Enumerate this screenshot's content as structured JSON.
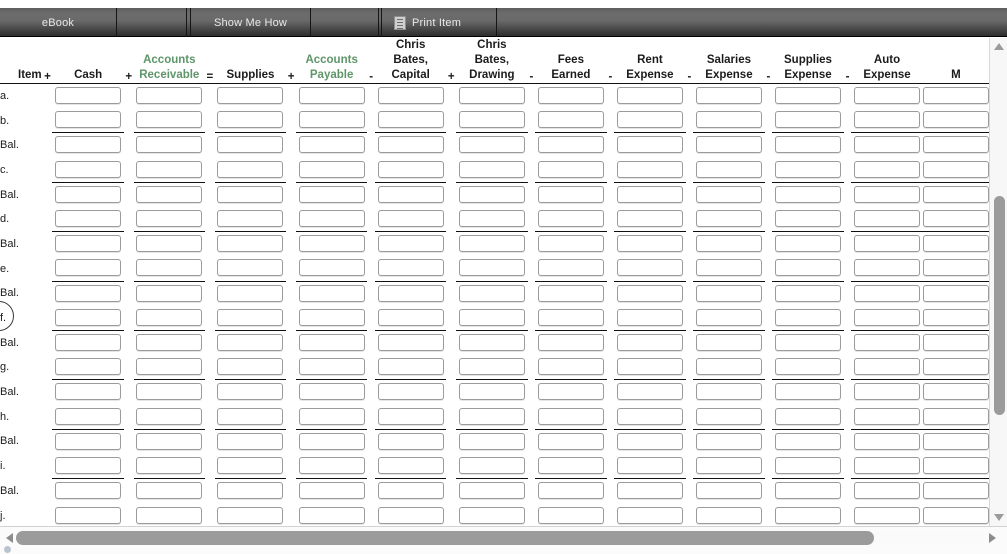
{
  "toolbar": {
    "buttons": [
      {
        "name": "ebook",
        "label": "eBook",
        "icon": ""
      },
      {
        "name": "spacer-1",
        "label": "",
        "icon": ""
      },
      {
        "name": "show-me-how",
        "label": "Show Me How",
        "icon": ""
      },
      {
        "name": "spacer-2",
        "label": "",
        "icon": ""
      },
      {
        "name": "print-item",
        "label": "Print Item",
        "icon": "document-icon"
      },
      {
        "name": "spacer-3",
        "label": "",
        "icon": ""
      }
    ]
  },
  "worksheet": {
    "columns": [
      {
        "key": "item",
        "line1": "",
        "line2": "Item",
        "color": "black",
        "op": ""
      },
      {
        "key": "cash",
        "line1": "",
        "line2": "Cash",
        "color": "black",
        "op": "+"
      },
      {
        "key": "accounts_receivable",
        "line1": "Accounts",
        "line2": "Receivable",
        "color": "green",
        "op": "+"
      },
      {
        "key": "supplies",
        "line1": "",
        "line2": "Supplies",
        "color": "black",
        "op": "="
      },
      {
        "key": "accounts_payable",
        "line1": "Accounts",
        "line2": "Payable",
        "color": "green",
        "op": "+"
      },
      {
        "key": "capital",
        "line1": "Chris",
        "line2": "Bates,",
        "line3": "Capital",
        "color": "black",
        "op": "-"
      },
      {
        "key": "drawing",
        "line1": "Chris",
        "line2": "Bates,",
        "line3": "Drawing",
        "color": "black",
        "op": "+"
      },
      {
        "key": "fees_earned",
        "line1": "Fees",
        "line2": "Earned",
        "color": "black",
        "op": "-"
      },
      {
        "key": "rent_expense",
        "line1": "Rent",
        "line2": "Expense",
        "color": "black",
        "op": "-"
      },
      {
        "key": "salaries_expense",
        "line1": "Salaries",
        "line2": "Expense",
        "color": "black",
        "op": "-"
      },
      {
        "key": "supplies_expense",
        "line1": "Supplies",
        "line2": "Expense",
        "color": "black",
        "op": "-"
      },
      {
        "key": "auto_expense",
        "line1": "Auto",
        "line2": "Expense",
        "color": "black",
        "op": "-"
      },
      {
        "key": "misc_expense",
        "line1": "",
        "line2": "M",
        "color": "black",
        "op": ""
      }
    ],
    "rows": [
      {
        "label": "a.",
        "ruled": false
      },
      {
        "label": "b.",
        "ruled": false
      },
      {
        "label": "Bal.",
        "ruled": true
      },
      {
        "label": "c.",
        "ruled": false
      },
      {
        "label": "Bal.",
        "ruled": true
      },
      {
        "label": "d.",
        "ruled": false
      },
      {
        "label": "Bal.",
        "ruled": true
      },
      {
        "label": "e.",
        "ruled": false
      },
      {
        "label": "Bal.",
        "ruled": true
      },
      {
        "label": "f.",
        "ruled": false
      },
      {
        "label": "Bal.",
        "ruled": true
      },
      {
        "label": "g.",
        "ruled": false
      },
      {
        "label": "Bal.",
        "ruled": true
      },
      {
        "label": "h.",
        "ruled": false
      },
      {
        "label": "Bal.",
        "ruled": true
      },
      {
        "label": "i.",
        "ruled": false
      },
      {
        "label": "Bal.",
        "ruled": true
      },
      {
        "label": "j.",
        "ruled": false
      }
    ],
    "field_value": ""
  },
  "scrollbars": {
    "vertical": {
      "up_icon": "triangle-up-icon",
      "down_icon": "triangle-down-icon",
      "thumb_position_pct": 34
    },
    "horizontal": {
      "left_icon": "triangle-left-icon",
      "right_icon": "triangle-right-icon",
      "thumb_width_pct": 88
    }
  },
  "colors": {
    "accent_green": "#5e9569",
    "text": "#1b1b1b",
    "toolbar_bg": "#5e5e5e",
    "scroll_thumb": "#9b9b9b"
  }
}
